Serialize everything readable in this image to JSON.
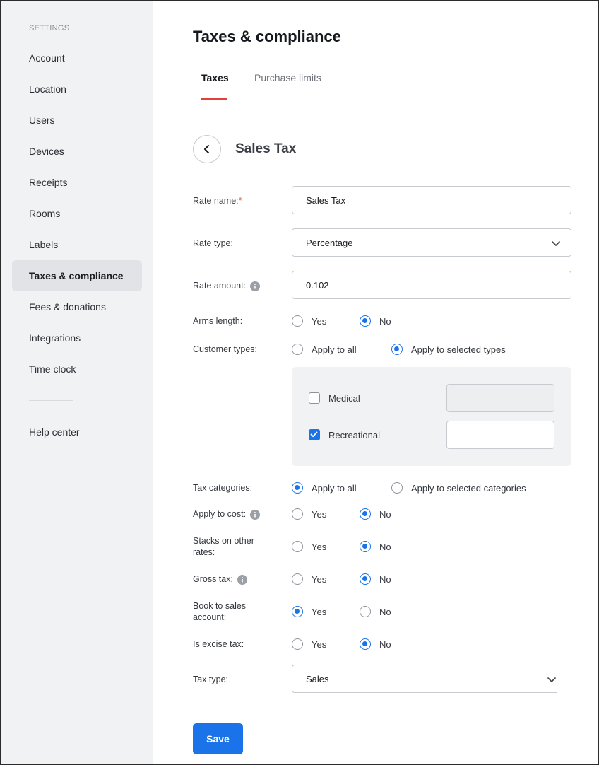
{
  "sidebar": {
    "heading": "SETTINGS",
    "items": [
      {
        "label": "Account"
      },
      {
        "label": "Location"
      },
      {
        "label": "Users"
      },
      {
        "label": "Devices"
      },
      {
        "label": "Receipts"
      },
      {
        "label": "Rooms"
      },
      {
        "label": "Labels"
      },
      {
        "label": "Taxes & compliance",
        "active": true
      },
      {
        "label": "Fees & donations"
      },
      {
        "label": "Integrations"
      },
      {
        "label": "Time clock"
      }
    ],
    "help": "Help center"
  },
  "page": {
    "title": "Taxes & compliance",
    "tabs": [
      {
        "label": "Taxes",
        "active": true
      },
      {
        "label": "Purchase limits",
        "active": false
      }
    ],
    "section_title": "Sales Tax"
  },
  "form": {
    "rate_name": {
      "label": "Rate name:",
      "required_mark": "*",
      "value": "Sales Tax"
    },
    "rate_type": {
      "label": "Rate type:",
      "value": "Percentage"
    },
    "rate_amount": {
      "label": "Rate amount:",
      "value": "0.102",
      "icon": "info-icon"
    },
    "arms_length": {
      "label": "Arms length:",
      "options": [
        "Yes",
        "No"
      ],
      "selected": "No"
    },
    "customer_types": {
      "label": "Customer types:",
      "options": [
        "Apply to all",
        "Apply to selected types"
      ],
      "selected": "Apply to selected types",
      "items": [
        {
          "label": "Medical",
          "checked": false,
          "value": ""
        },
        {
          "label": "Recreational",
          "checked": true,
          "value": ""
        }
      ]
    },
    "tax_categories": {
      "label": "Tax categories:",
      "options": [
        "Apply to all",
        "Apply to selected categories"
      ],
      "selected": "Apply to all"
    },
    "apply_to_cost": {
      "label": "Apply to cost:",
      "options": [
        "Yes",
        "No"
      ],
      "selected": "No",
      "icon": "info-icon"
    },
    "stacks_on_other_rates": {
      "label_line1": "Stacks on other",
      "label_line2": "rates:",
      "options": [
        "Yes",
        "No"
      ],
      "selected": "No"
    },
    "gross_tax": {
      "label": "Gross tax:",
      "options": [
        "Yes",
        "No"
      ],
      "selected": "No",
      "icon": "info-icon"
    },
    "book_to_sales_account": {
      "label_line1": "Book to sales",
      "label_line2": "account:",
      "options": [
        "Yes",
        "No"
      ],
      "selected": "Yes"
    },
    "is_excise_tax": {
      "label": "Is excise tax:",
      "options": [
        "Yes",
        "No"
      ],
      "selected": "No"
    },
    "tax_type": {
      "label": "Tax type:",
      "value": "Sales"
    }
  },
  "actions": {
    "save_label": "Save"
  },
  "colors": {
    "accent": "#1a73e8",
    "tab_indicator": "#e2413a",
    "required": "#e2413a",
    "sidebar_bg": "#f1f2f3"
  }
}
